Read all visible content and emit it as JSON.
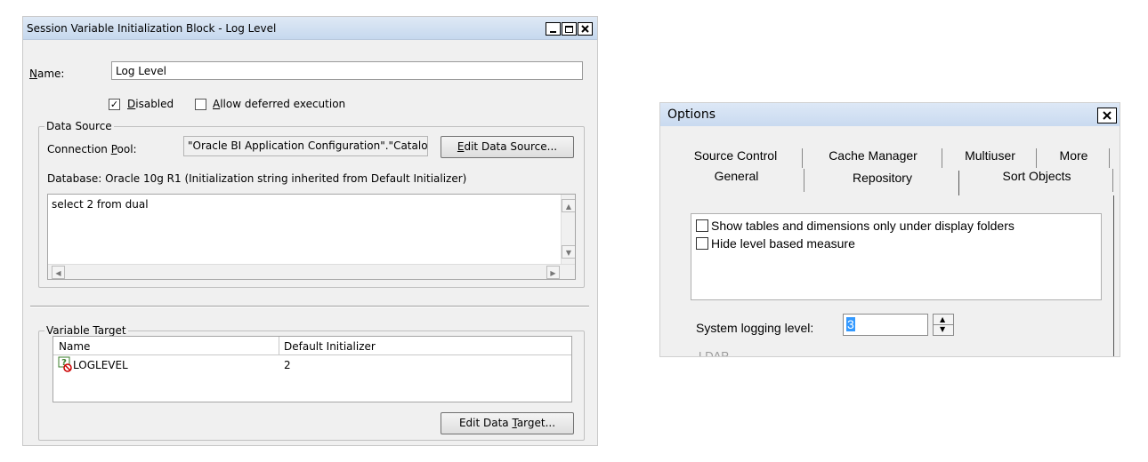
{
  "session_dialog": {
    "title": "Session Variable Initialization Block - Log Level",
    "name_label": "Name:",
    "name_value": "Log Level",
    "disabled_label": "Disabled",
    "disabled_checked": true,
    "deferred_label": "Allow deferred execution",
    "deferred_checked": false,
    "data_source": {
      "title": "Data Source",
      "conn_pool_label": "Connection Pool:",
      "conn_pool_value": "\"Oracle BI Application Configuration\".\"Catalo",
      "edit_button": "Edit Data Source...",
      "database_info": "Database: Oracle 10g R1 (Initialization string inherited from Default Initializer)",
      "sql": "select 2 from dual"
    },
    "variable_target": {
      "title": "Variable Target",
      "columns": [
        "Name",
        "Default Initializer"
      ],
      "rows": [
        {
          "name": "LOGLEVEL",
          "default": "2"
        }
      ],
      "edit_button": "Edit Data Target..."
    }
  },
  "options_dialog": {
    "title": "Options",
    "tabs_row1": [
      "Source Control",
      "Cache Manager",
      "Multiuser",
      "More"
    ],
    "tabs_row2": [
      "General",
      "Repository",
      "Sort Objects"
    ],
    "active_tab": "Repository",
    "checkboxes": [
      {
        "label": "Show tables and dimensions only under display folders",
        "checked": false
      },
      {
        "label": "Hide level based measure",
        "checked": false
      }
    ],
    "logging_label": "System logging level:",
    "logging_value": "3",
    "ldap_label": "LDAP"
  }
}
